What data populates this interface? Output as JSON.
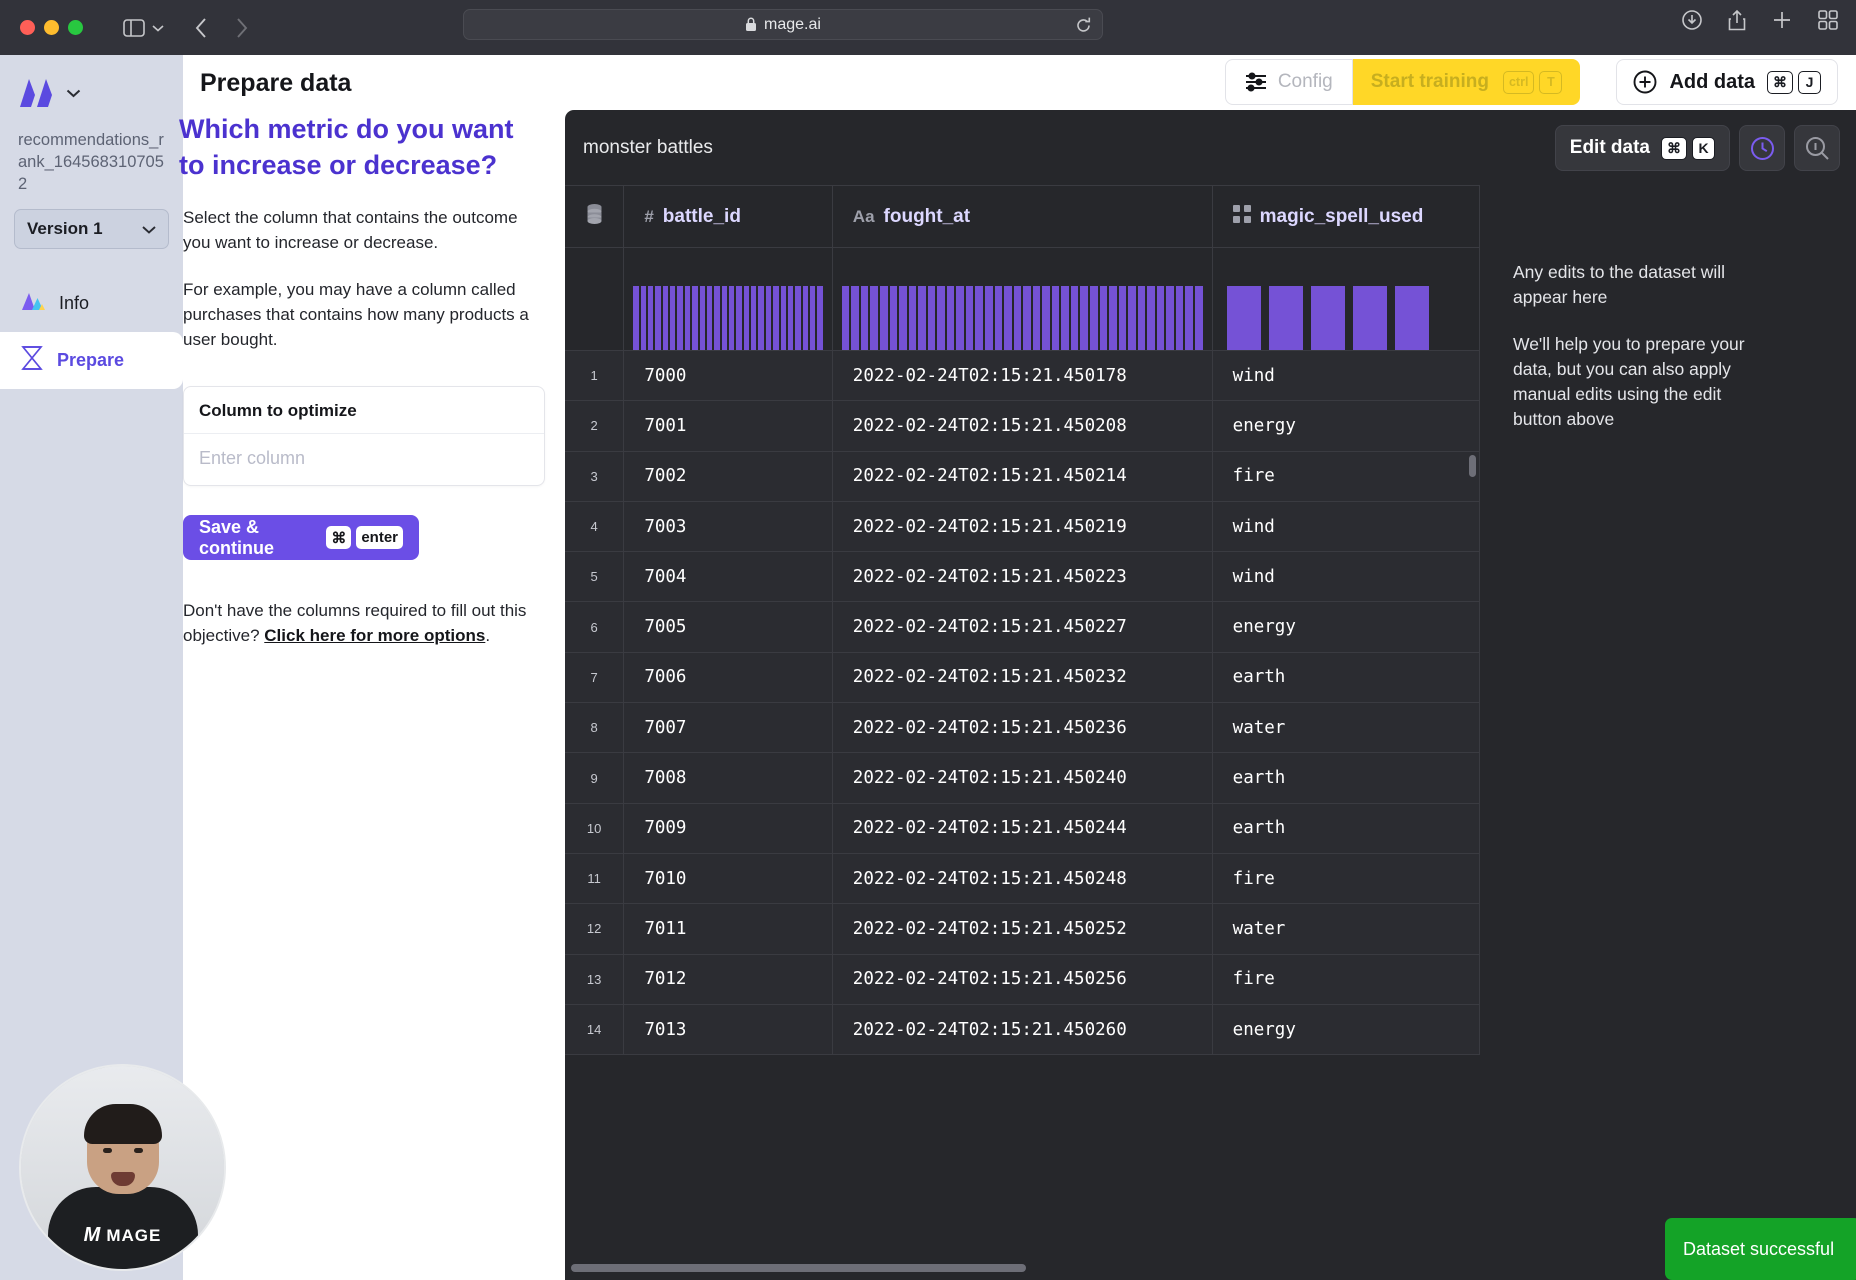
{
  "browser": {
    "url": "mage.ai",
    "lock_icon": "lock-icon",
    "shield_icon": "shield-icon",
    "back_icon": "chevron-left-icon",
    "forward_icon": "chevron-right-icon",
    "sidebar_icon": "sidebar-toggle-icon",
    "download_icon": "download-icon",
    "share_icon": "share-icon",
    "newtab_icon": "plus-icon",
    "tabs_icon": "tab-overview-icon",
    "reload_icon": "reload-icon"
  },
  "sidebar": {
    "brand": "M",
    "brand_caret": "chevron-down-icon",
    "project_name": "recommendations_rank_1645683107052",
    "version": {
      "label": "Version 1",
      "caret": "chevron-down-icon"
    },
    "items": [
      {
        "label": "Info",
        "icon": "mountain-icon",
        "active": false
      },
      {
        "label": "Prepare",
        "icon": "hourglass-icon",
        "active": true
      }
    ]
  },
  "header": {
    "title": "Prepare data",
    "config_label": "Config",
    "config_icon": "sliders-icon",
    "start_training_label": "Start training",
    "start_training_keys": [
      "ctrl",
      "T"
    ],
    "add_data_label": "Add data",
    "add_data_icon": "plus-circle-icon",
    "add_data_keys": [
      "⌘",
      "J"
    ]
  },
  "prepare": {
    "question": "Which metric do you want to increase or decrease?",
    "paragraph_1": "Select the column that contains the outcome you want to increase or decrease.",
    "paragraph_2": "For example, you may have a column called purchases that contains how many products a user bought.",
    "field_label": "Column to optimize",
    "field_placeholder": "Enter column",
    "field_value": "",
    "save_label": "Save & continue",
    "save_keys": [
      "⌘",
      "enter"
    ],
    "footnote_prefix": "Don't have the columns required to fill out this objective? ",
    "footnote_link": "Click here for more options",
    "footnote_suffix": "."
  },
  "data_panel": {
    "dataset_name": "monster battles",
    "edit_data_label": "Edit data",
    "edit_data_keys": [
      "⌘",
      "K"
    ],
    "history_icon": "clock-icon",
    "search_icon": "search-zoom-icon",
    "notes": [
      "Any edits to the dataset will appear here",
      "We'll help you to prepare your data, but you can also apply manual edits using the edit button above"
    ],
    "columns": [
      {
        "name": "",
        "type_icon": "database-icon",
        "type_label": ""
      },
      {
        "name": "battle_id",
        "type_icon": "number-icon",
        "type_label": "#"
      },
      {
        "name": "fought_at",
        "type_icon": "text-icon",
        "type_label": "Aa"
      },
      {
        "name": "magic_spell_used",
        "type_icon": "category-grid-icon",
        "type_label": ""
      }
    ],
    "rows": [
      {
        "idx": "1",
        "battle_id": "7000",
        "fought_at": "2022-02-24T02:15:21.450178",
        "magic_spell_used": "wind"
      },
      {
        "idx": "2",
        "battle_id": "7001",
        "fought_at": "2022-02-24T02:15:21.450208",
        "magic_spell_used": "energy"
      },
      {
        "idx": "3",
        "battle_id": "7002",
        "fought_at": "2022-02-24T02:15:21.450214",
        "magic_spell_used": "fire"
      },
      {
        "idx": "4",
        "battle_id": "7003",
        "fought_at": "2022-02-24T02:15:21.450219",
        "magic_spell_used": "wind"
      },
      {
        "idx": "5",
        "battle_id": "7004",
        "fought_at": "2022-02-24T02:15:21.450223",
        "magic_spell_used": "wind"
      },
      {
        "idx": "6",
        "battle_id": "7005",
        "fought_at": "2022-02-24T02:15:21.450227",
        "magic_spell_used": "energy"
      },
      {
        "idx": "7",
        "battle_id": "7006",
        "fought_at": "2022-02-24T02:15:21.450232",
        "magic_spell_used": "earth"
      },
      {
        "idx": "8",
        "battle_id": "7007",
        "fought_at": "2022-02-24T02:15:21.450236",
        "magic_spell_used": "water"
      },
      {
        "idx": "9",
        "battle_id": "7008",
        "fought_at": "2022-02-24T02:15:21.450240",
        "magic_spell_used": "earth"
      },
      {
        "idx": "10",
        "battle_id": "7009",
        "fought_at": "2022-02-24T02:15:21.450244",
        "magic_spell_used": "earth"
      },
      {
        "idx": "11",
        "battle_id": "7010",
        "fought_at": "2022-02-24T02:15:21.450248",
        "magic_spell_used": "fire"
      },
      {
        "idx": "12",
        "battle_id": "7011",
        "fought_at": "2022-02-24T02:15:21.450252",
        "magic_spell_used": "water"
      },
      {
        "idx": "13",
        "battle_id": "7012",
        "fought_at": "2022-02-24T02:15:21.450256",
        "magic_spell_used": "fire"
      },
      {
        "idx": "14",
        "battle_id": "7013",
        "fought_at": "2022-02-24T02:15:21.450260",
        "magic_spell_used": "energy"
      }
    ],
    "histograms": {
      "battle_id_bars": 26,
      "fought_at_bars": 38,
      "magic_spell_used_bars": 5
    }
  },
  "toast": {
    "message": "Dataset successful",
    "color": "#14a327"
  },
  "webcam": {
    "logo_text": "MAGE"
  },
  "colors": {
    "accent_purple": "#6b4ee6",
    "heading_purple": "#4b32cf",
    "brand_yellow": "#ffd727",
    "panel_dark": "#26272b",
    "row_dark": "#2b2c31",
    "hist_purple": "#7552d6",
    "success_green": "#14a327"
  }
}
